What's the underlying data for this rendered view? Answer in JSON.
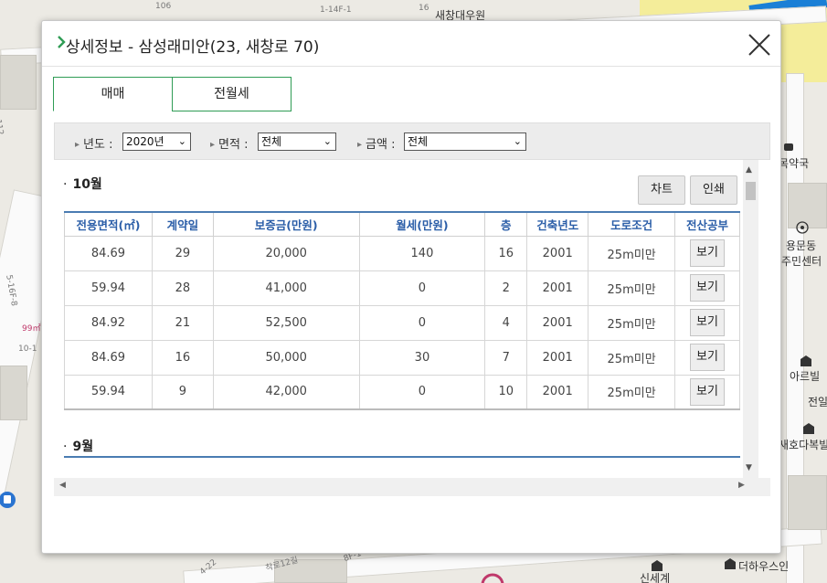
{
  "map": {
    "labels": [
      "106",
      "1-14F-1",
      "16",
      "새창대우원",
      "목약국",
      "용문동",
      "주민센터",
      "아르빌",
      "전일",
      "새호다복빌",
      "더하우스인",
      "신세계",
      "99㎡",
      "10-1",
      "5-16F-8",
      "착로12길",
      "4-22",
      "8F-1",
      "112"
    ]
  },
  "dialog": {
    "title": "상세정보 - 삼성래미안(23, 새창로 70)",
    "tabs": [
      "매매",
      "전월세"
    ],
    "filters": {
      "year_label": "년도 :",
      "year_value": "2020년",
      "area_label": "면적 :",
      "area_value": "전체",
      "amount_label": "금액 :",
      "amount_value": "전체"
    },
    "chart_btn": "차트",
    "print_btn": "인쇄",
    "months": [
      "10월",
      "9월"
    ],
    "columns": [
      "전용면적(㎡)",
      "계약일",
      "보증금(만원)",
      "월세(만원)",
      "층",
      "건축년도",
      "도로조건",
      "전산공부"
    ],
    "rows": [
      {
        "area": "84.69",
        "day": "29",
        "deposit": "20,000",
        "rent": "140",
        "floor": "16",
        "year": "2001",
        "road": "25m미만",
        "view": "보기"
      },
      {
        "area": "59.94",
        "day": "28",
        "deposit": "41,000",
        "rent": "0",
        "floor": "2",
        "year": "2001",
        "road": "25m미만",
        "view": "보기"
      },
      {
        "area": "84.92",
        "day": "21",
        "deposit": "52,500",
        "rent": "0",
        "floor": "4",
        "year": "2001",
        "road": "25m미만",
        "view": "보기"
      },
      {
        "area": "84.69",
        "day": "16",
        "deposit": "50,000",
        "rent": "30",
        "floor": "7",
        "year": "2001",
        "road": "25m미만",
        "view": "보기"
      },
      {
        "area": "59.94",
        "day": "9",
        "deposit": "42,000",
        "rent": "0",
        "floor": "10",
        "year": "2001",
        "road": "25m미만",
        "view": "보기"
      }
    ]
  },
  "colors": {
    "accent_green": "#2f9c55",
    "header_blue": "#2b5ea8"
  }
}
